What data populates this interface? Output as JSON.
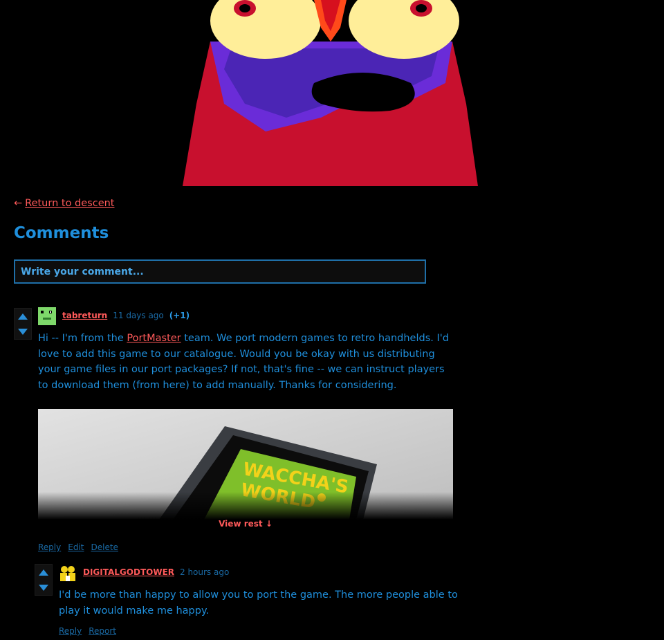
{
  "nav": {
    "back_arrow": "←",
    "back_label": "Return to descent"
  },
  "comments": {
    "title": "Comments",
    "input_placeholder": "Write your comment..."
  },
  "thread": [
    {
      "user": "tabreturn",
      "time": "11 days ago",
      "score": "(+1)",
      "text_before": "Hi -- I'm from the ",
      "link": "PortMaster",
      "text_after": " team. We port modern games to retro handhelds. I'd love to add this game to our catalogue. Would you be okay with us distributing your game files in our port packages? If not, that's fine -- we can instruct players to download them (from here) to add manually. Thanks for considering.",
      "view_rest": "View rest ↓",
      "actions": [
        "Reply",
        "Edit",
        "Delete"
      ]
    },
    {
      "user": "DIGITALGODTOWER",
      "time": "2 hours ago",
      "text": "I'd be more than happy to allow you to port the game. The more people able to play it would make me happy.",
      "actions": [
        "Reply",
        "Report"
      ]
    }
  ],
  "colors": {
    "link": "#ff5a5a",
    "text": "#1f8fdc",
    "background": "#000000"
  },
  "icons": {
    "upvote": "triangle-up-icon",
    "downvote": "triangle-down-icon",
    "back": "left-arrow-icon"
  }
}
